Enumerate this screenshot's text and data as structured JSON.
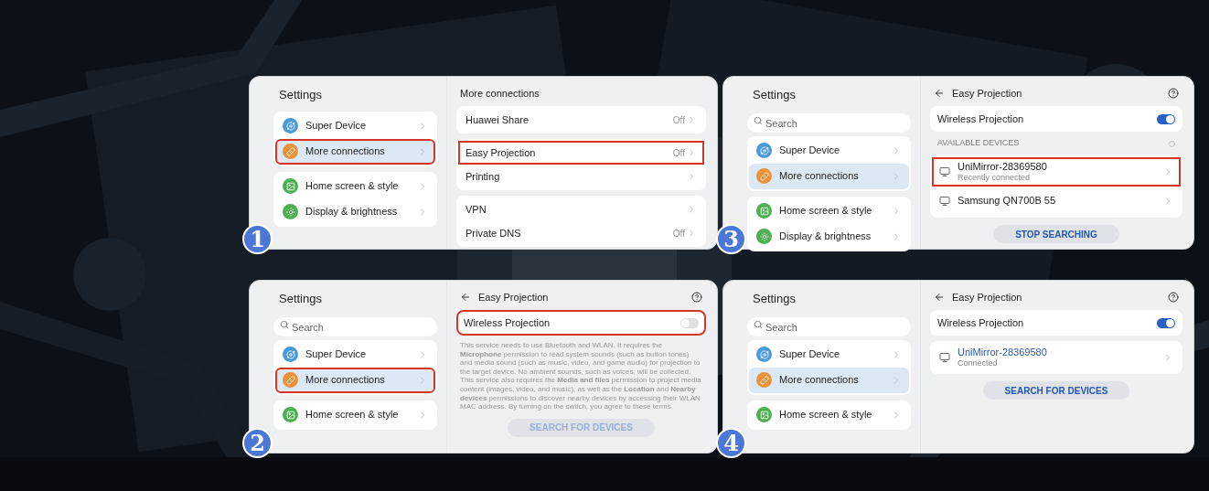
{
  "panels": [
    {
      "step": "1",
      "sidebar": {
        "title": "Settings",
        "groups": [
          [
            {
              "label": "Super Device",
              "color": "#4a9ad6",
              "selected": false,
              "highlighted": false
            },
            {
              "label": "More connections",
              "color": "#e8923a",
              "selected": true,
              "highlighted": true
            }
          ],
          [
            {
              "label": "Home screen & style",
              "color": "#4caf50",
              "selected": false,
              "highlighted": false
            },
            {
              "label": "Display & brightness",
              "color": "#4caf50",
              "selected": false,
              "highlighted": false
            }
          ]
        ]
      },
      "detail": {
        "title": "More connections",
        "back": false,
        "help": false,
        "blocks": [
          {
            "kind": "group",
            "rows": [
              {
                "kind": "nav",
                "label": "Huawei Share",
                "value": "Off",
                "highlighted": false
              }
            ]
          },
          {
            "kind": "group",
            "rows": [
              {
                "kind": "nav",
                "label": "Easy Projection",
                "value": "Off",
                "highlighted": true
              },
              {
                "kind": "nav",
                "label": "Printing",
                "highlighted": false
              }
            ]
          },
          {
            "kind": "group",
            "rows": [
              {
                "kind": "nav",
                "label": "VPN",
                "highlighted": false
              },
              {
                "kind": "nav",
                "label": "Private DNS",
                "value": "Off",
                "highlighted": false
              }
            ]
          }
        ]
      }
    },
    {
      "step": "3",
      "sidebar": {
        "title": "Settings",
        "search": {
          "placeholder": "Search"
        },
        "groups": [
          [
            {
              "label": "Super Device",
              "color": "#4a9ad6",
              "selected": false,
              "highlighted": false
            },
            {
              "label": "More connections",
              "color": "#e8923a",
              "selected": true,
              "highlighted": false
            }
          ],
          [
            {
              "label": "Home screen & style",
              "color": "#4caf50",
              "selected": false,
              "highlighted": false
            },
            {
              "label": "Display & brightness",
              "color": "#4caf50",
              "selected": false,
              "highlighted": false
            }
          ]
        ]
      },
      "detail": {
        "title": "Easy Projection",
        "back": true,
        "help": true,
        "blocks": [
          {
            "kind": "toggle",
            "label": "Wireless Projection",
            "on": true,
            "highlighted": false
          },
          {
            "kind": "section_label",
            "label": "AVAILABLE DEVICES",
            "loading": true
          },
          {
            "kind": "group",
            "rows": [
              {
                "kind": "device",
                "label": "UniMirror-28369580",
                "subtitle": "Recently connected",
                "connected": false,
                "highlighted": true
              },
              {
                "kind": "device",
                "label": "Samsung QN700B 55",
                "connected": false,
                "highlighted": false
              }
            ]
          },
          {
            "kind": "button",
            "label": "STOP SEARCHING",
            "disabled": false
          }
        ]
      }
    },
    {
      "step": "2",
      "sidebar": {
        "title": "Settings",
        "search": {
          "placeholder": "Search"
        },
        "groups": [
          [
            {
              "label": "Super Device",
              "color": "#4a9ad6",
              "selected": false,
              "highlighted": false
            },
            {
              "label": "More connections",
              "color": "#e8923a",
              "selected": true,
              "highlighted": true
            }
          ],
          [
            {
              "label": "Home screen & style",
              "color": "#4caf50",
              "selected": false,
              "highlighted": false
            }
          ]
        ]
      },
      "detail": {
        "title": "Easy Projection",
        "back": true,
        "help": true,
        "blocks": [
          {
            "kind": "toggle",
            "label": "Wireless Projection",
            "on": false,
            "highlighted": true
          },
          {
            "kind": "notice",
            "text": "This service needs to use Bluetooth and WLAN. It requires the **Microphone** permission to read system sounds (such as button tones) and media sound (such as music, video, and game audio) for projection to the target device. No ambient sounds, such as voices, will be collected. This service also requires the **Media and files** permission to project media content (images, video, and music), as well as the **Location** and **Nearby devices** permissions to discover nearby devices by accessing their WLAN MAC address. By turning on the switch, you agree to these terms."
          },
          {
            "kind": "button",
            "label": "SEARCH FOR DEVICES",
            "disabled": true
          }
        ]
      }
    },
    {
      "step": "4",
      "sidebar": {
        "title": "Settings",
        "search": {
          "placeholder": "Search"
        },
        "groups": [
          [
            {
              "label": "Super Device",
              "color": "#4a9ad6",
              "selected": false,
              "highlighted": false
            },
            {
              "label": "More connections",
              "color": "#e8923a",
              "selected": true,
              "highlighted": false
            }
          ],
          [
            {
              "label": "Home screen & style",
              "color": "#4caf50",
              "selected": false,
              "highlighted": false
            }
          ]
        ]
      },
      "detail": {
        "title": "Easy Projection",
        "back": true,
        "help": true,
        "blocks": [
          {
            "kind": "toggle",
            "label": "Wireless Projection",
            "on": true,
            "highlighted": false
          },
          {
            "kind": "group",
            "rows": [
              {
                "kind": "device",
                "label": "UniMirror-28369580",
                "subtitle": "Connected",
                "connected": true,
                "highlighted": false
              }
            ]
          },
          {
            "kind": "button",
            "label": "SEARCH FOR DEVICES",
            "disabled": false
          }
        ]
      }
    }
  ]
}
